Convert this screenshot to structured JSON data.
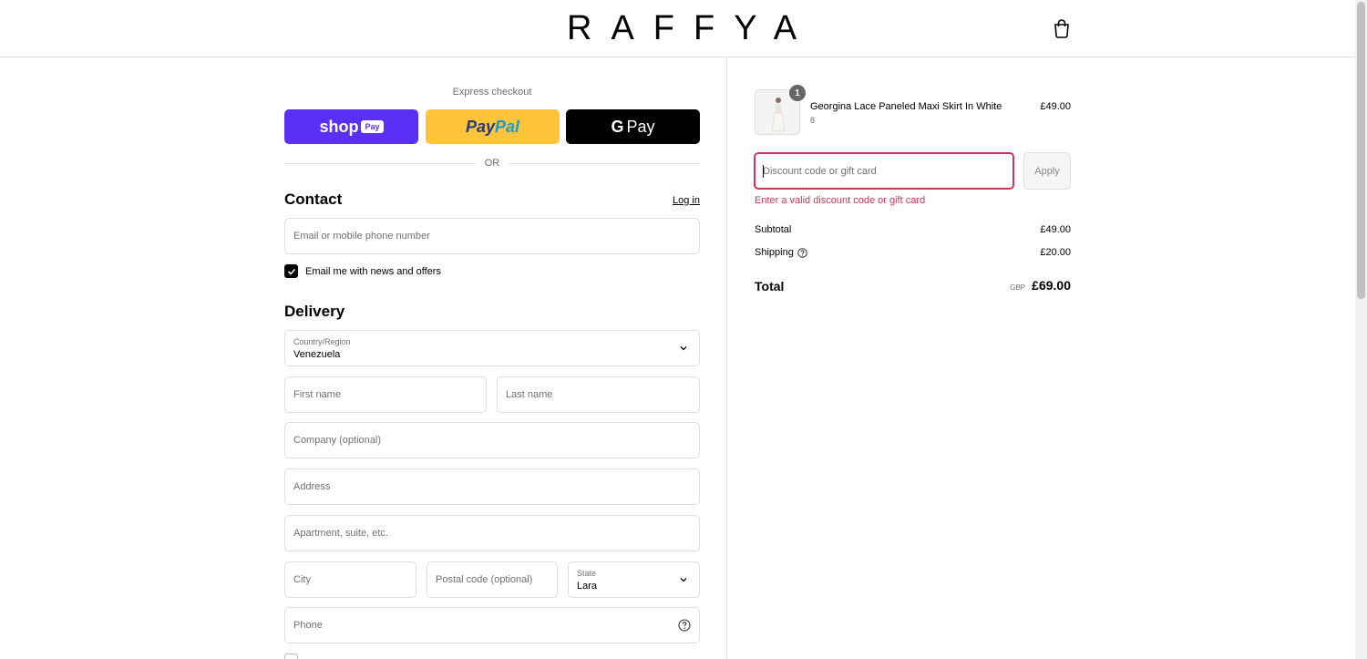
{
  "header": {
    "logo": "RAFFYA",
    "cart_icon": "shopping-bag-icon"
  },
  "express": {
    "label": "Express checkout",
    "shop_pay": {
      "shop": "shop",
      "pay": "Pay"
    },
    "paypal": {
      "pay": "Pay",
      "pal": "Pal"
    },
    "gpay": {
      "g": "G",
      "pay": "Pay"
    },
    "or": "OR"
  },
  "contact": {
    "title": "Contact",
    "login": "Log in",
    "email_placeholder": "Email or mobile phone number",
    "newsletter_label": "Email me with news and offers"
  },
  "delivery": {
    "title": "Delivery",
    "country_label": "Country/Region",
    "country_value": "Venezuela",
    "first_name": "First name",
    "last_name": "Last name",
    "company": "Company (optional)",
    "address": "Address",
    "apartment": "Apartment, suite, etc.",
    "city": "City",
    "postal": "Postal code (optional)",
    "state_label": "State",
    "state_value": "Lara",
    "phone": "Phone"
  },
  "order": {
    "item": {
      "name": "Georgina Lace Paneled Maxi Skirt In White",
      "variant": "8",
      "price": "£49.00",
      "quantity": "1"
    },
    "discount_placeholder": "Discount code or gift card",
    "apply": "Apply",
    "error": "Enter a valid discount code or gift card",
    "subtotal_label": "Subtotal",
    "subtotal_value": "£49.00",
    "shipping_label": "Shipping",
    "shipping_value": "£20.00",
    "total_label": "Total",
    "total_currency": "GBP",
    "total_value": "£69.00"
  },
  "colors": {
    "shop_pay": "#5a31f4",
    "paypal": "#ffc439",
    "gpay": "#000000",
    "error": "#d1335b"
  }
}
